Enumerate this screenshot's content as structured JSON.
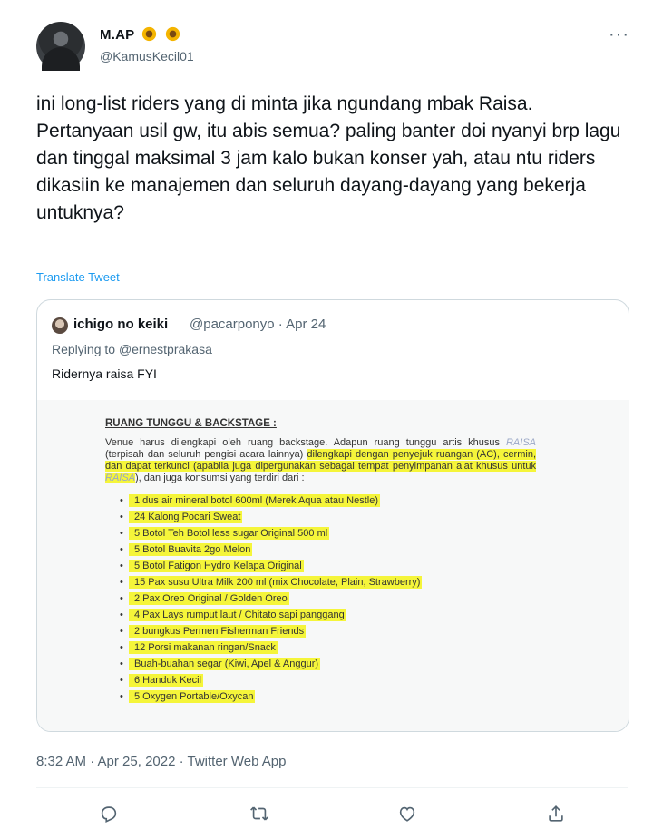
{
  "author": {
    "name": "M.AP",
    "name_emoji": "sunflower",
    "handle": "@KamusKecil01"
  },
  "more_icon": "more-horizontal-icon",
  "tweet": {
    "text": "ini long-list riders yang di minta jika ngundang mbak Raisa. Pertanyaan usil gw, itu abis semua? paling banter doi nyanyi  brp lagu dan tinggal maksimal 3 jam kalo bukan konser yah, atau ntu riders dikasiin ke manajemen dan seluruh dayang-dayang yang bekerja untuknya?",
    "translate_label": "Translate Tweet"
  },
  "quoted": {
    "name": "ichigo no keiki",
    "handle_date": "@pacarponyo · Apr 24",
    "replying_label": "Replying to",
    "replying_to": "@ernestprakasa",
    "text": "Ridernya raisa FYI",
    "document": {
      "heading": "RUANG TUNGGU & BACKSTAGE :",
      "para_part1": "Venue harus dilengkapi oleh ruang backstage. Adapun ruang tunggu artis khusus",
      "raisa_1": "RAISA",
      "para_part2": "(terpisah dan seluruh pengisi acara lainnya)",
      "para_hl": "dilengkapi dengan penyejuk ruangan (AC), cermin, dan dapat terkunci (apabila juga dipergunakan sebagai tempat penyimpanan alat khusus untuk",
      "raisa_2": "RAISA",
      "para_part3": "), dan juga konsumsi yang terdiri dari :",
      "items": [
        "1 dus air mineral botol 600ml (Merek Aqua atau Nestle)",
        "24 Kalong Pocari Sweat",
        "5  Botol Teh Botol less sugar Original 500 ml",
        "5  Botol Buavita 2go Melon",
        "5  Botol Fatigon Hydro Kelapa Original",
        "15 Pax susu Ultra Milk 200 ml (mix Chocolate, Plain, Strawberry)",
        "2 Pax Oreo Original / Golden Oreo",
        "4 Pax Lays rumput laut / Chitato sapi panggang",
        "2 bungkus Permen Fisherman Friends",
        "12 Porsi makanan ringan/Snack",
        "Buah-buahan segar (Kiwi, Apel & Anggur)",
        "6 Handuk Kecil",
        "5 Oxygen Portable/Oxycan"
      ]
    }
  },
  "meta": {
    "timestamp": "8:32 AM · Apr 25, 2022 · Twitter Web App"
  },
  "actions": [
    "reply-icon",
    "retweet-icon",
    "like-icon",
    "share-icon"
  ],
  "colors": {
    "link": "#1d9bf0",
    "secondary": "#536471",
    "highlight": "#f5f53a"
  }
}
